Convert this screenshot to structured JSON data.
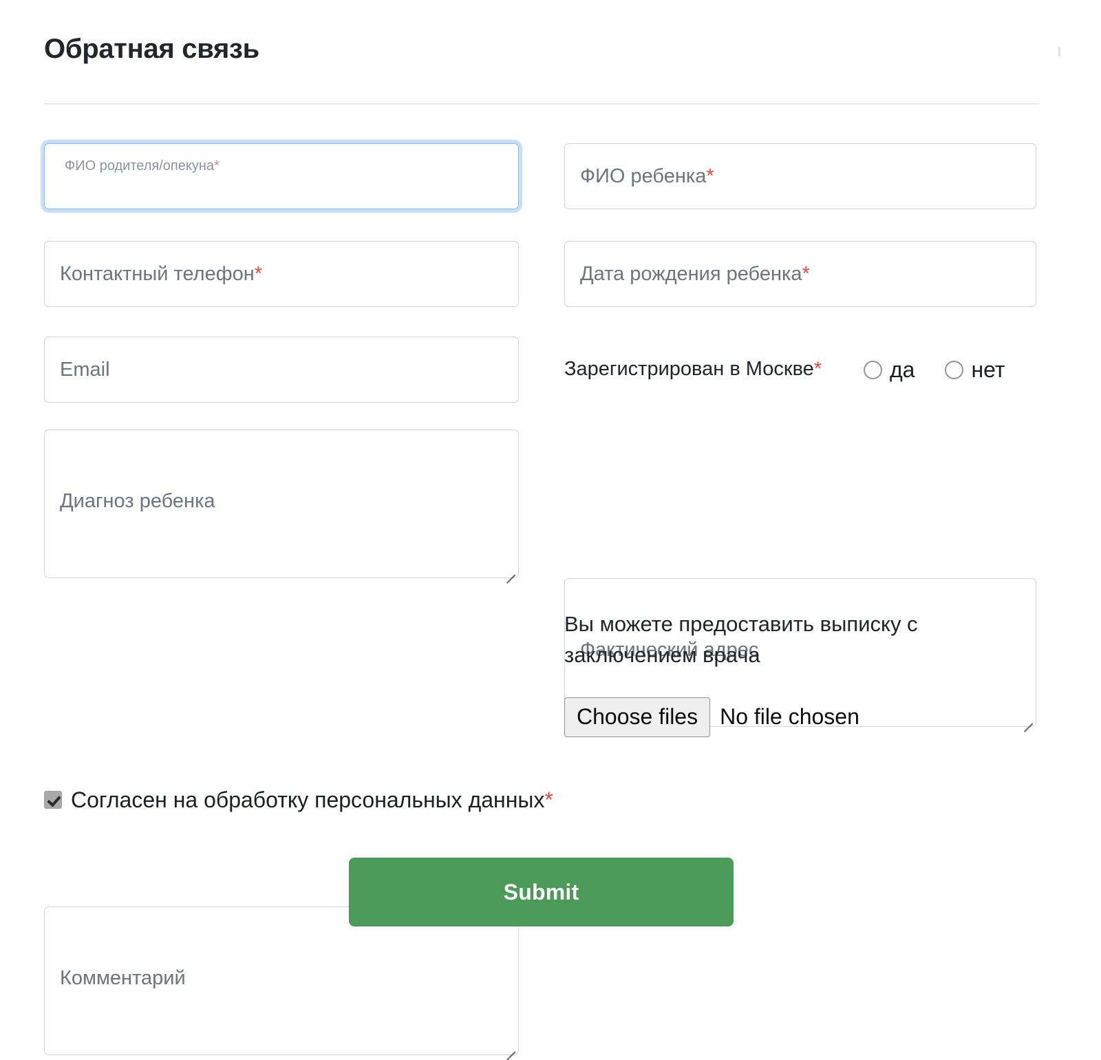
{
  "header": {
    "title": "Обратная связь"
  },
  "fields": {
    "parent_name": {
      "label": "ФИО родителя/опекуна",
      "required_mark": "*",
      "value": "",
      "placeholder": "",
      "state": "focused"
    },
    "child_name": {
      "placeholder": "ФИО ребенка",
      "required_mark": "*",
      "value": ""
    },
    "phone": {
      "placeholder": "Контактный телефон",
      "required_mark": "*",
      "value": ""
    },
    "birth_date": {
      "placeholder": "Дата рождения ребенка",
      "required_mark": "*",
      "value": ""
    },
    "email": {
      "placeholder": "Email",
      "required_mark": "",
      "value": ""
    },
    "diagnosis": {
      "placeholder": "Диагноз ребенка",
      "required_mark": "",
      "value": ""
    },
    "address": {
      "placeholder": "Фактический адрес",
      "required_mark": "",
      "value": ""
    },
    "comment": {
      "placeholder": "Комментарий",
      "required_mark": "",
      "value": ""
    }
  },
  "registration": {
    "question": "Зарегистрирован в Москве",
    "required_mark": "*",
    "options": [
      {
        "label": "да",
        "checked": false
      },
      {
        "label": "нет",
        "checked": false
      }
    ]
  },
  "upload": {
    "note": "Вы можете предоставить выписку с заключением врача",
    "button_label": "Choose files",
    "status_text": "No file chosen"
  },
  "consent": {
    "label": "Согласен на обработку персональных данных",
    "required_mark": "*",
    "checked": true
  },
  "submit": {
    "label": "Submit"
  },
  "colors": {
    "submit_green": "#4c9a57",
    "required_red": "#e8493a",
    "focus_blue": "#80bdff",
    "border_gray": "#ced4da",
    "placeholder_gray": "#6c757d",
    "divider_gray": "#e6eaee"
  }
}
